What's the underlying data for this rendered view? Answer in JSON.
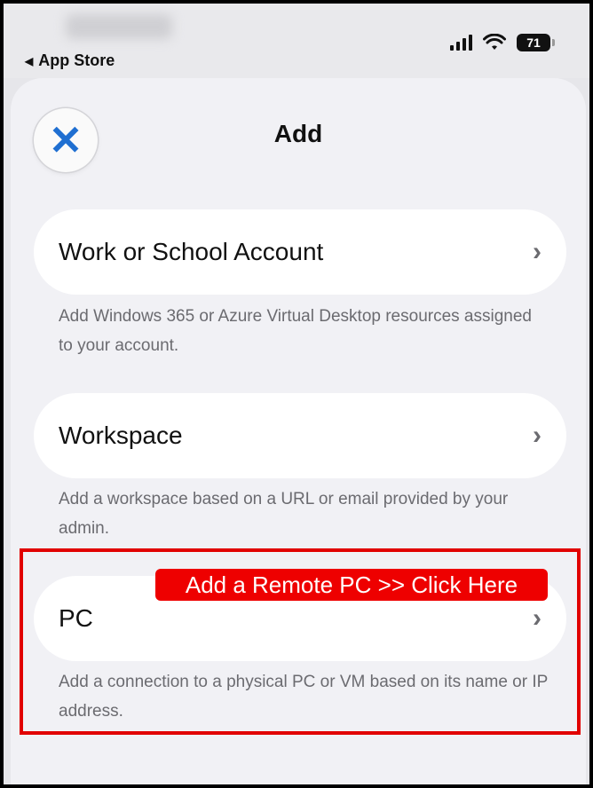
{
  "status_bar": {
    "back_app_label": "App Store",
    "battery_level": "71"
  },
  "sheet": {
    "title": "Add",
    "close_icon": "close-icon"
  },
  "options": [
    {
      "label": "Work or School Account",
      "description": "Add Windows 365 or Azure Virtual Desktop resources assigned to your account."
    },
    {
      "label": "Workspace",
      "description": "Add a workspace based on a URL or email provided by your admin."
    },
    {
      "label": "PC",
      "description": "Add a connection to a physical PC or VM based on its name or IP address."
    }
  ],
  "annotation": {
    "callout_text": "Add a Remote PC >> Click Here",
    "highlight_color": "#e10000"
  },
  "colors": {
    "accent": "#1f6fd1",
    "sheet_bg": "#f1f1f5",
    "card_bg": "#ffffff",
    "secondary_text": "#6b6b70"
  }
}
